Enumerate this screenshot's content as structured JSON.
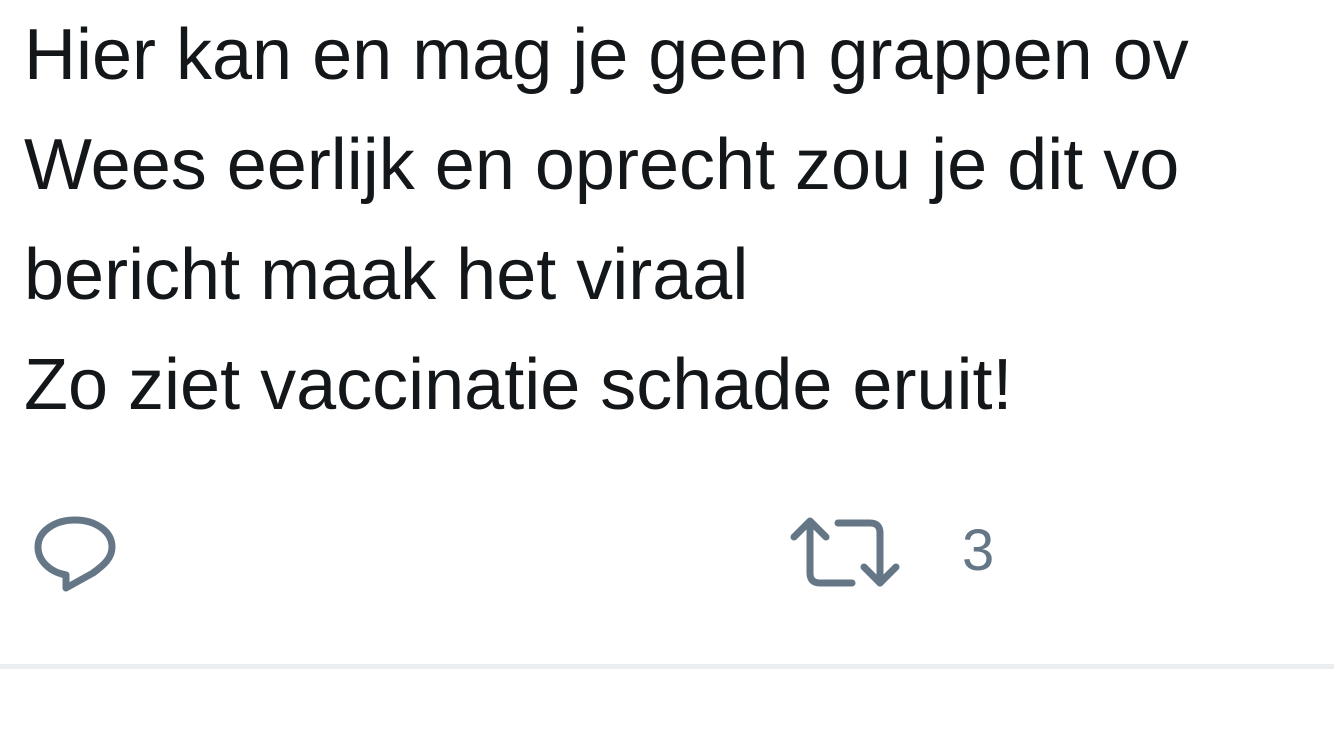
{
  "tweet": {
    "lines": [
      "Hier kan en mag je geen grappen ov",
      "Wees eerlijk en oprecht zou je dit vo",
      "bericht maak het viraal",
      "Zo ziet vaccinatie schade eruit!"
    ]
  },
  "actions": {
    "reply_icon": "speech-bubble-icon",
    "retweet_icon": "retweet-arrows-icon",
    "retweet_count": "3",
    "icon_color": "#657786"
  },
  "colors": {
    "text": "#14171a",
    "divider": "#eaeef1",
    "background": "#ffffff"
  }
}
